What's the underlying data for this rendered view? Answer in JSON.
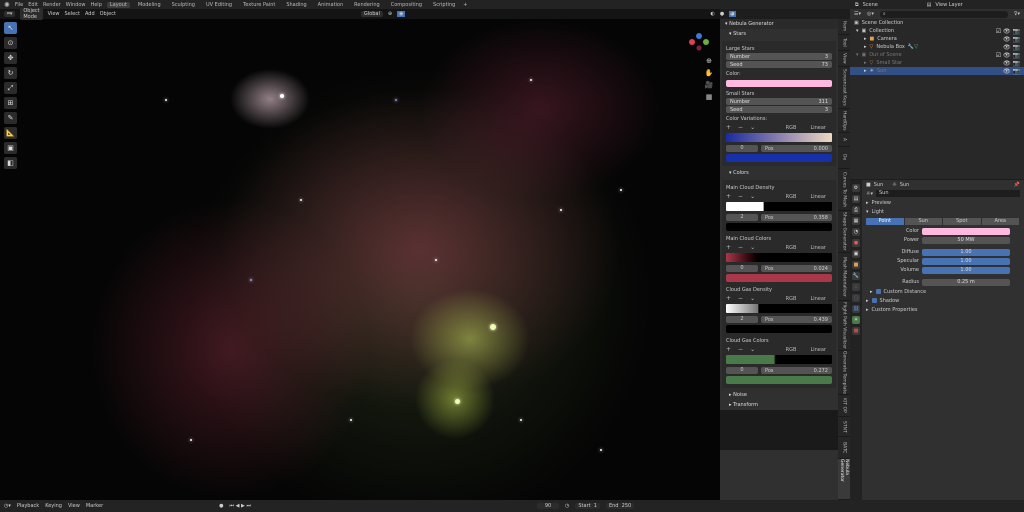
{
  "menu": [
    "File",
    "Edit",
    "Render",
    "Window",
    "Help"
  ],
  "workspaces": [
    "Layout",
    "Modeling",
    "Sculpting",
    "UV Editing",
    "Texture Paint",
    "Shading",
    "Animation",
    "Rendering",
    "Compositing",
    "Scripting"
  ],
  "active_workspace": "Layout",
  "scene": "Scene",
  "view_layer": "View Layer",
  "viewport_header": {
    "mode": "Object Mode",
    "view": "View",
    "select": "Select",
    "add": "Add",
    "object": "Object",
    "orientation": "Global"
  },
  "npanel": {
    "title": "Nebula Generator",
    "stars_section": "Stars",
    "large_stars": {
      "label": "Large Stars",
      "number_label": "Number",
      "number": "3",
      "seed_label": "Seed",
      "seed": "73"
    },
    "color_label": "Color:",
    "color": "#ffb8e0",
    "small_stars": {
      "label": "Small Stars",
      "number_label": "Number",
      "number": "311",
      "seed_label": "Seed",
      "seed": "3"
    },
    "color_variations": {
      "label": "Color Variations:",
      "mode": "RGB",
      "interp": "Linear",
      "index": "0",
      "pos_label": "Pos",
      "pos": "0.000",
      "color": "#1530a8"
    },
    "colors_section": "Colors",
    "main_cloud_density": {
      "label": "Main Cloud Density",
      "mode": "RGB",
      "interp": "Linear",
      "index": "2",
      "pos_label": "Pos",
      "pos": "0.358",
      "color": "#000000"
    },
    "main_cloud_colors": {
      "label": "Main Cloud Colors",
      "mode": "RGB",
      "interp": "Linear",
      "index": "0",
      "pos_label": "Pos",
      "pos": "0.024",
      "color": "#a8384a"
    },
    "cloud_gas_density": {
      "label": "Cloud Gas Density",
      "mode": "RGB",
      "interp": "Linear",
      "index": "2",
      "pos_label": "Pos",
      "pos": "0.439",
      "color": "#000000"
    },
    "cloud_gas_colors": {
      "label": "Cloud Gas Colors",
      "mode": "RGB",
      "interp": "Linear",
      "index": "0",
      "pos_label": "Pos",
      "pos": "0.272",
      "color": "#4a7a4a"
    },
    "noise_section": "Noise",
    "transform_section": "Transform"
  },
  "side_tabs": [
    "Item",
    "Tool",
    "View",
    "Screencast Keys",
    "HardOps",
    "A",
    "De",
    "Curves To Mesh",
    "Shape Generator",
    "Mesh Materializer",
    "Flight Path Visualizer",
    "Generate Template",
    "KIT OP",
    "STNT",
    "BATC",
    "Nebula Generator"
  ],
  "outliner": {
    "root": "Scene Collection",
    "items": [
      {
        "name": "Collection",
        "depth": 1,
        "dim": false
      },
      {
        "name": "Camera",
        "depth": 2,
        "dim": false
      },
      {
        "name": "Nebula Box",
        "depth": 2,
        "dim": false
      },
      {
        "name": "Out of Scene",
        "depth": 1,
        "dim": true
      },
      {
        "name": "Small Star",
        "depth": 2,
        "dim": true
      },
      {
        "name": "Sun",
        "depth": 2,
        "dim": true,
        "selected": true
      }
    ]
  },
  "properties": {
    "object": "Sun",
    "data": "Sun",
    "datablock": "Sun",
    "preview": "Preview",
    "light": "Light",
    "types": [
      "Point",
      "Sun",
      "Spot",
      "Area"
    ],
    "active_type": "Point",
    "color_label": "Color",
    "color": "#ffb8e0",
    "power_label": "Power",
    "power": "50 MW",
    "diffuse_label": "Diffuse",
    "diffuse": "1.00",
    "specular_label": "Specular",
    "specular": "1.00",
    "volume_label": "Volume",
    "volume": "1.00",
    "radius_label": "Radius",
    "radius": "0.25 m",
    "custom_distance": "Custom Distance",
    "shadow": "Shadow",
    "custom_properties": "Custom Properties"
  },
  "timeline": {
    "playback": "Playback",
    "keying": "Keying",
    "view": "View",
    "marker": "Marker",
    "current_frame": "90",
    "start_label": "Start",
    "start": "1",
    "end_label": "End",
    "end": "250"
  }
}
